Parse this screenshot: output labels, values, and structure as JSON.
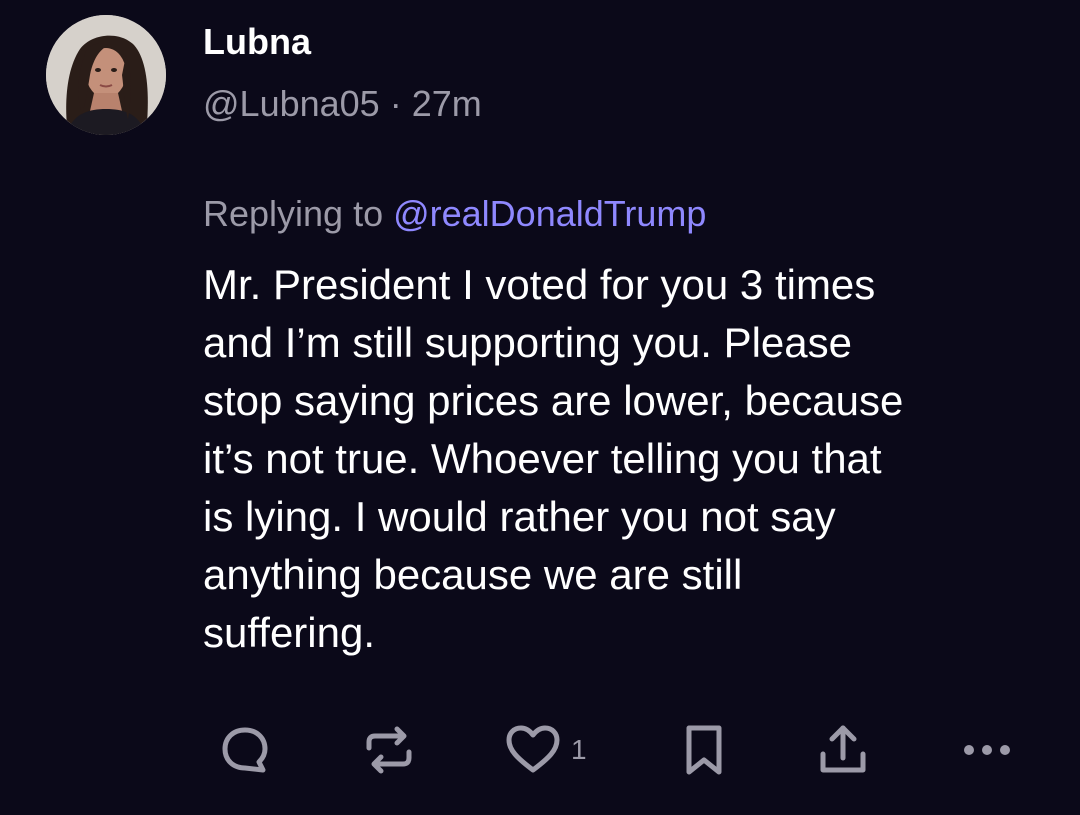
{
  "author": {
    "display_name": "Lubna",
    "handle": "@Lubna05",
    "separator": " · ",
    "time": "27m"
  },
  "reply": {
    "prefix": "Replying to ",
    "handle": "@realDonaldTrump"
  },
  "post_text": "Mr. President I voted for you 3 times\nand I’m still supporting you. Please\nstop saying prices are lower, because\nit’s not true. Whoever telling you that\nis lying. I would rather you not say\nanything because we are still\nsuffering.",
  "actions": {
    "comment_icon": "comment-icon",
    "repost_icon": "repost-icon",
    "like_icon": "heart-icon",
    "like_count": "1",
    "bookmark_icon": "bookmark-icon",
    "share_icon": "share-icon",
    "more_icon": "more-icon"
  },
  "colors": {
    "background": "#0b0919",
    "muted_text": "#9c9aa8",
    "link": "#8f88ff",
    "text": "#ffffff"
  }
}
